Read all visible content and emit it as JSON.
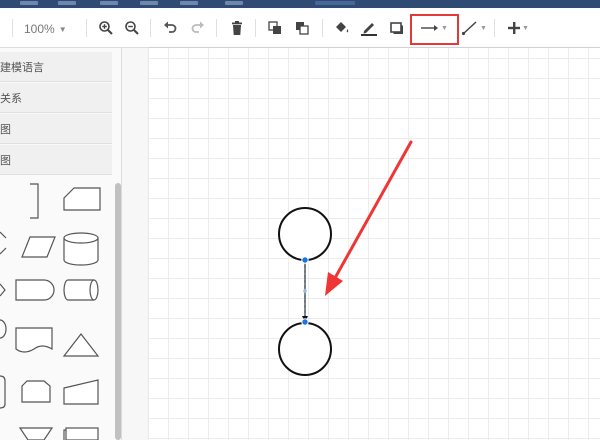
{
  "toolbar": {
    "zoom_value": "100%",
    "items": [
      "zoom-in",
      "zoom-out",
      "undo",
      "redo",
      "delete",
      "to-front",
      "to-back",
      "fill-color",
      "line-color",
      "shadow",
      "connection-style",
      "waypoints",
      "insert"
    ]
  },
  "sidebar": {
    "categories": [
      {
        "label": "建模语言"
      },
      {
        "label": "关系"
      },
      {
        "label": "图"
      },
      {
        "label": "图"
      }
    ]
  },
  "colors": {
    "accent": "#1a73e8",
    "highlight_box": "#e53935",
    "annotation_arrow": "#f03535",
    "menubar": "#2f4a73"
  }
}
